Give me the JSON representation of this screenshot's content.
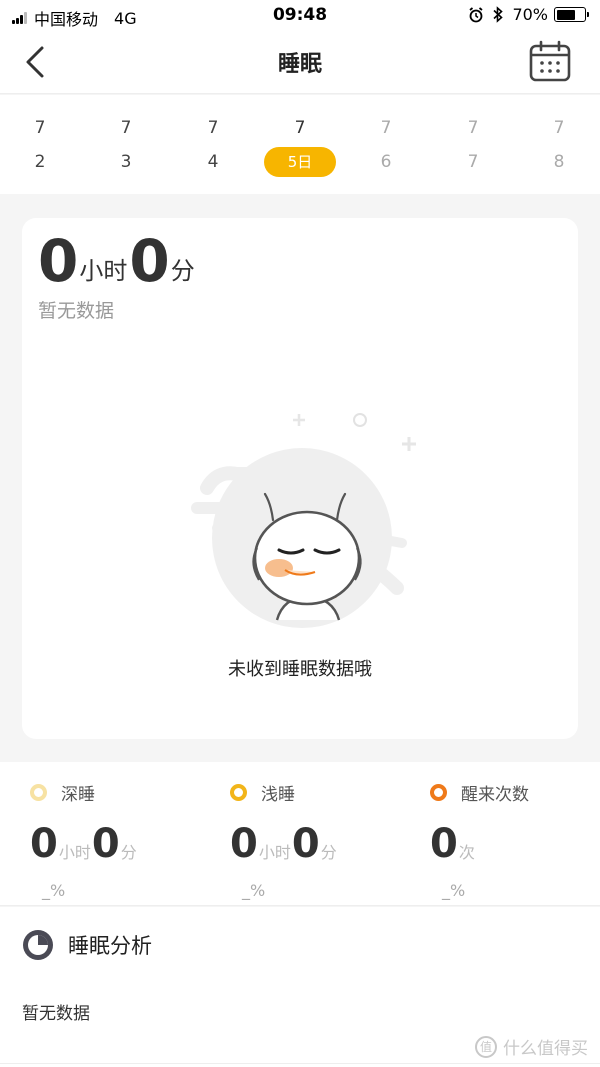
{
  "status_bar": {
    "carrier": "中国移动",
    "network": "4G",
    "time": "09:48",
    "battery_text": "70%",
    "battery_level": 0.7,
    "icons": [
      "signal-icon",
      "alarm-icon",
      "bluetooth-icon",
      "battery-icon"
    ]
  },
  "nav": {
    "title": "睡眠",
    "back_icon": "chevron-left-icon",
    "calendar_icon": "calendar-icon"
  },
  "dates": [
    {
      "month": "7",
      "day": "2",
      "state": "past"
    },
    {
      "month": "7",
      "day": "3",
      "state": "past"
    },
    {
      "month": "7",
      "day": "4",
      "state": "past"
    },
    {
      "month": "7",
      "day": "5日",
      "state": "selected"
    },
    {
      "month": "7",
      "day": "6",
      "state": "future"
    },
    {
      "month": "7",
      "day": "7",
      "state": "future"
    },
    {
      "month": "7",
      "day": "8",
      "state": "future"
    }
  ],
  "summary": {
    "hours": "0",
    "hour_unit": "小时",
    "minutes": "0",
    "minute_unit": "分",
    "no_data": "暂无数据",
    "empty_message": "未收到睡眠数据哦"
  },
  "stats": [
    {
      "label": "深睡",
      "color": "#f7e2a3",
      "value_parts": [
        "0",
        "小时",
        "0",
        "分"
      ],
      "percent": "_%"
    },
    {
      "label": "浅睡",
      "color": "#f2b51a",
      "value_parts": [
        "0",
        "小时",
        "0",
        "分"
      ],
      "percent": "_%"
    },
    {
      "label": "醒来次数",
      "color": "#ef7a1a",
      "value_parts": [
        "0",
        "次"
      ],
      "percent": "_%"
    }
  ],
  "analysis": {
    "title": "睡眠分析",
    "empty": "暂无数据",
    "icon": "pie-chart-icon"
  },
  "watermark": {
    "badge": "值",
    "text": "什么值得买"
  },
  "colors": {
    "accent": "#f7b500",
    "page_bg": "#f5f5f5",
    "card_bg": "#ffffff"
  }
}
